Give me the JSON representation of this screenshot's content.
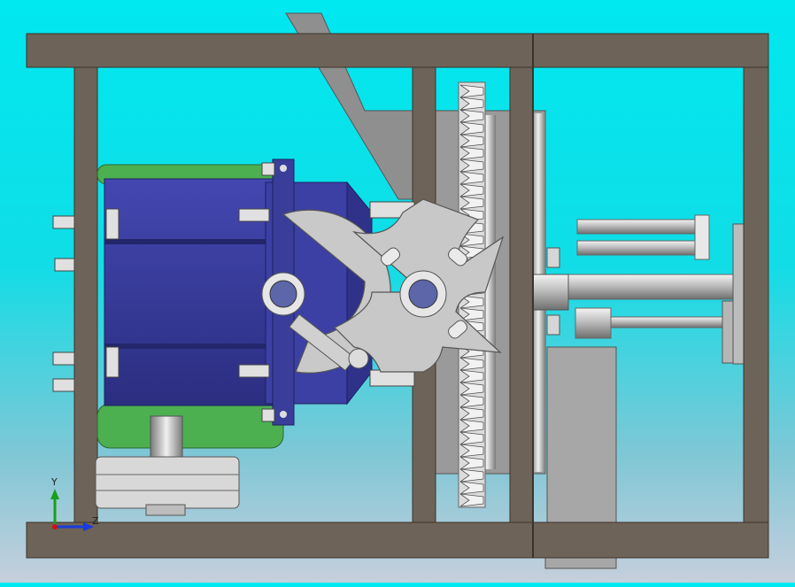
{
  "viewport": {
    "background_top": "#00e8f0",
    "background_bottom": "#c6cfdc"
  },
  "colors": {
    "frame": "#6e6358",
    "frame_edge": "#3c332b",
    "motor_body": "#3a3e9a",
    "motor_dark": "#23266a",
    "motor_base": "#4caf50",
    "steel": "#c4c4c4",
    "steel_dark": "#8a8a8a",
    "bolt": "#e0e0e0"
  },
  "triad": {
    "y_label": "Y",
    "z_label": "Z",
    "y_color": "#19a019",
    "z_color": "#1a3cdc",
    "x_color": "#d01010"
  }
}
